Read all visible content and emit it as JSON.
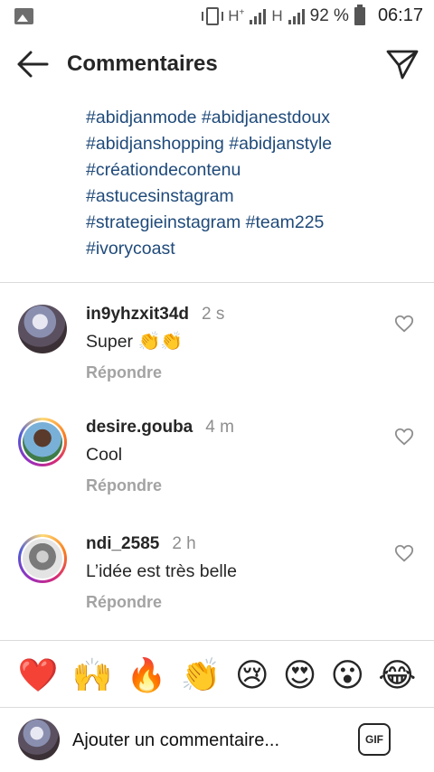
{
  "status_bar": {
    "network_1": "H",
    "network_1_sup": "+",
    "network_2": "H",
    "battery_percent": "92 %",
    "time": "06:17",
    "signal_1_level": 4,
    "signal_2_level": 4
  },
  "header": {
    "title": "Commentaires"
  },
  "caption": {
    "hashtag_lines": [
      "#abidjanmode #abidjanestdoux",
      "#abidjanshopping #abidjanstyle",
      "#créationdecontenu",
      "#astucesinstagram",
      "#strategieinstagram #team225",
      "#ivorycoast"
    ],
    "hashtag_color": "#1f4a7a"
  },
  "comments": [
    {
      "username": "in9yhzxit34d",
      "time": "2 s",
      "text": "Super",
      "emojis": "👏👏",
      "reply_label": "Répondre",
      "avatar_ring": false
    },
    {
      "username": "desire.gouba",
      "time": "4 m",
      "text": "Cool",
      "emojis": "",
      "reply_label": "Répondre",
      "avatar_ring": true
    },
    {
      "username": "ndi_2585",
      "time": "2 h",
      "text": "L’idée est très belle",
      "emojis": "",
      "reply_label": "Répondre",
      "avatar_ring": true
    }
  ],
  "emoji_bar": [
    "❤️",
    "🙌",
    "🔥",
    "👏",
    "😢",
    "😍",
    "😮",
    "😂"
  ],
  "input": {
    "placeholder": "Ajouter un commentaire...",
    "gif_label": "GIF"
  },
  "icons": {
    "back": "arrow-left-icon",
    "send": "paper-plane-icon",
    "like": "heart-outline-icon"
  }
}
